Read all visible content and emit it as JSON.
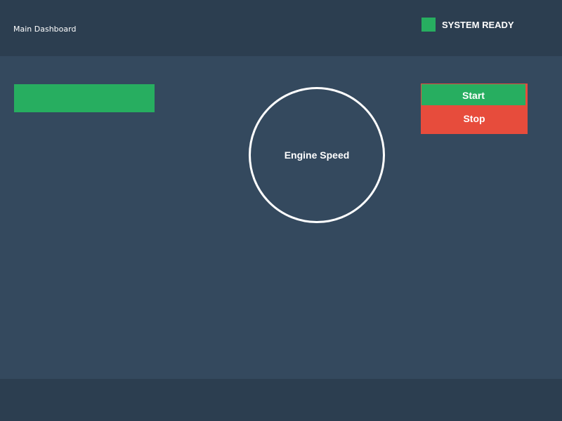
{
  "header": {
    "title": "Main Dashboard",
    "status_label": "SYSTEM READY",
    "status_color": "#27ae60"
  },
  "main": {
    "status_bar_color": "#27ae60",
    "gauge": {
      "label": "Engine Speed"
    },
    "controls": {
      "start_label": "Start",
      "stop_label": "Stop",
      "start_color": "#27ae60",
      "stop_color": "#e74c3c"
    }
  },
  "colors": {
    "header_bg": "#2c3e50",
    "main_bg": "#34495e",
    "footer_bg": "#2c3e50"
  }
}
